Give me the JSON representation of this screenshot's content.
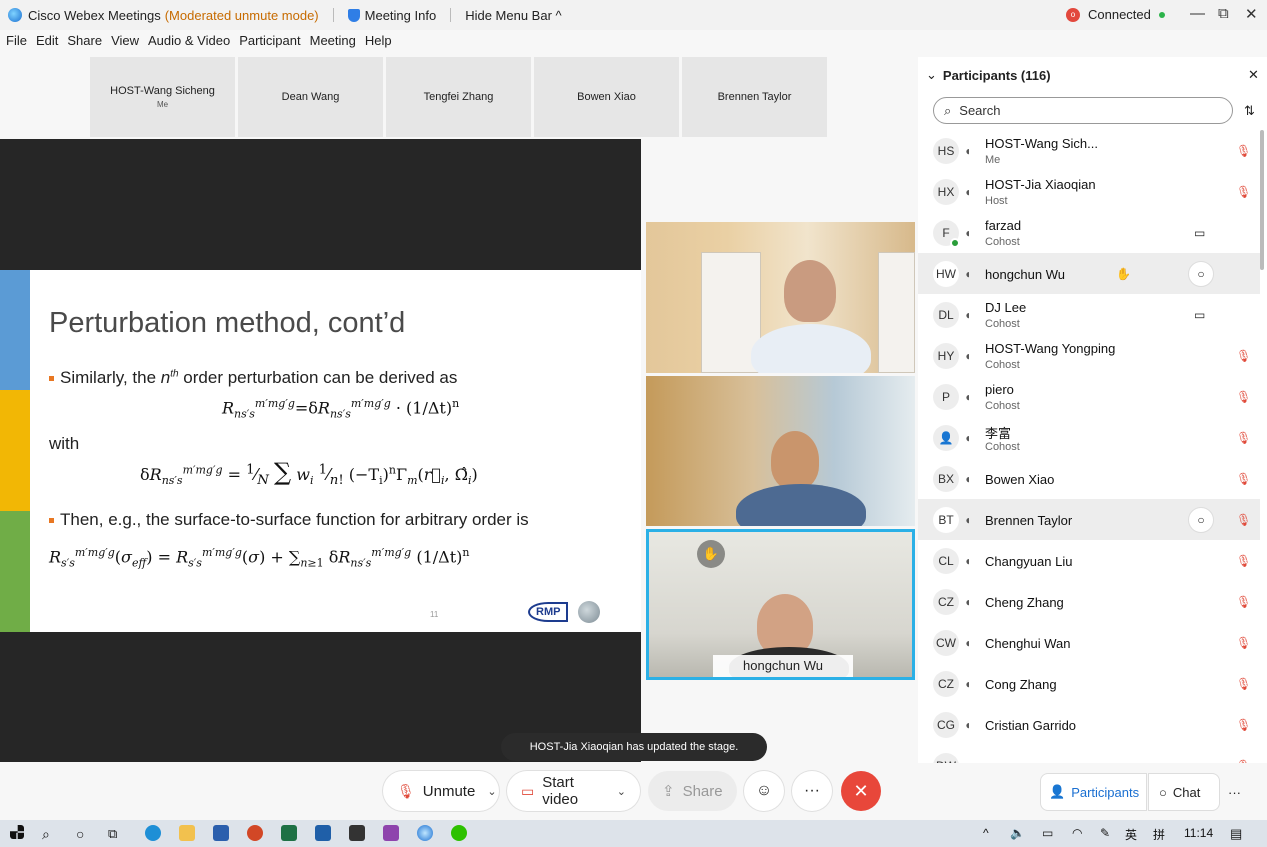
{
  "titlebar": {
    "app_name": "Cisco Webex Meetings",
    "mode": "(Moderated unmute mode)",
    "meeting_info": "Meeting Info",
    "hide_menu": "Hide Menu Bar ^",
    "rec_indicator": "o",
    "status": "Connected",
    "minimize": "—",
    "maximize": "⧉",
    "close": "✕"
  },
  "menu": [
    "File",
    "Edit",
    "Share",
    "View",
    "Audio & Video",
    "Participant",
    "Meeting",
    "Help"
  ],
  "thumbnails": [
    {
      "name": "HOST-Wang Sicheng",
      "sub": "Me"
    },
    {
      "name": "Dean Wang",
      "sub": ""
    },
    {
      "name": "Tengfei Zhang",
      "sub": ""
    },
    {
      "name": "Bowen Xiao",
      "sub": ""
    },
    {
      "name": "Brennen Taylor",
      "sub": ""
    }
  ],
  "slide": {
    "title": "Perturbation method, cont’d",
    "bullet1_pre": "Similarly, the ",
    "bullet1_sup_base": "n",
    "bullet1_sup": "th",
    "bullet1_post": " order perturbation can be derived as",
    "eq1": "R_ns's^m'mg'g = δR_ns's^m'mg'g · (1/Δt)^n",
    "with": "with",
    "eq2": "δR_ns's^m'mg'g = (1/N) Σ_{r_i∈∂V_is, E_i∈E_g} w_i (1/n!) (−T_i)^n Γ_m(r_i, Ω_i)",
    "bullet2": "Then, e.g., the surface-to-surface function for arbitrary order is",
    "eq3": "R_s's^m'mg'g(σ_eff) = R_s's^m'mg'g(σ) + Σ_n≥1 δR_ns's^m'mg'g (1/Δt)^n",
    "page_number": "11",
    "logo": "RMP",
    "stripe_colors": [
      "#5b9bd5",
      "#f2b705",
      "#70ad47"
    ]
  },
  "video": {
    "speaker_label": "hongchun Wu"
  },
  "toast": "HOST-Jia Xiaoqian has updated the stage.",
  "controls": {
    "unmute": "Unmute",
    "start_video": "Start video",
    "share": "Share",
    "emoji": "☺",
    "more": "···",
    "leave": "✕",
    "participants_tab": "Participants",
    "chat_tab": "Chat",
    "tabs_more": "···"
  },
  "panel": {
    "title": "Participants (116)",
    "search_placeholder": "Search",
    "participants": [
      {
        "initials": "HS",
        "name": "HOST-Wang Sich...",
        "role": "Me",
        "status": "muted-lock"
      },
      {
        "initials": "HX",
        "name": "HOST-Jia Xiaoqian",
        "role": "Host",
        "status": "muted"
      },
      {
        "initials": "F",
        "name": "farzad",
        "role": "Cohost",
        "status": "video"
      },
      {
        "initials": "HW",
        "name": "hongchun Wu",
        "role": "",
        "status": "hand-chat"
      },
      {
        "initials": "DL",
        "name": "DJ Lee",
        "role": "Cohost",
        "status": "video"
      },
      {
        "initials": "HY",
        "name": "HOST-Wang Yongping",
        "role": "Cohost",
        "status": "muted"
      },
      {
        "initials": "P",
        "name": "piero",
        "role": "Cohost",
        "status": "muted"
      },
      {
        "initials": "",
        "name": "李富",
        "role": "Cohost",
        "status": "muted"
      },
      {
        "initials": "BX",
        "name": "Bowen Xiao",
        "role": "",
        "status": "muted-lock"
      },
      {
        "initials": "BT",
        "name": "Brennen Taylor",
        "role": "",
        "status": "chat-muted-lock"
      },
      {
        "initials": "CL",
        "name": "Changyuan Liu",
        "role": "",
        "status": "muted-lock"
      },
      {
        "initials": "CZ",
        "name": "Cheng Zhang",
        "role": "",
        "status": "muted-lock"
      },
      {
        "initials": "CW",
        "name": "Chenghui Wan",
        "role": "",
        "status": "muted-lock"
      },
      {
        "initials": "CZ",
        "name": "Cong Zhang",
        "role": "",
        "status": "muted-lock"
      },
      {
        "initials": "CG",
        "name": "Cristian Garrido",
        "role": "",
        "status": "muted-lock"
      },
      {
        "initials": "DW",
        "name": "",
        "role": "",
        "status": "muted"
      }
    ]
  },
  "taskbar": {
    "tray_text": "英",
    "ime": "拼",
    "time": "11:14"
  }
}
